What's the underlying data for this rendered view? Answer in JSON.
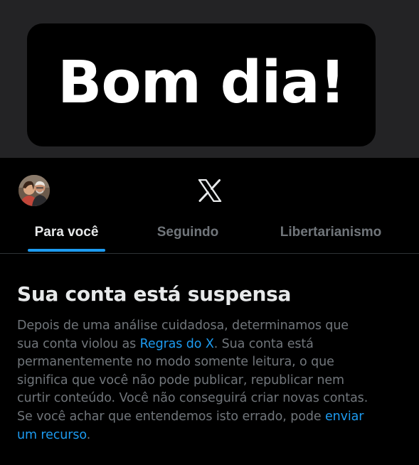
{
  "caption": {
    "text": "Bom dia!"
  },
  "header": {
    "logo_icon": "x-logo-icon",
    "avatar_icon": "profile-avatar"
  },
  "tabs": [
    {
      "label": "Para você",
      "active": true
    },
    {
      "label": "Seguindo",
      "active": false
    },
    {
      "label": "Libertarianismo",
      "active": false
    }
  ],
  "notice": {
    "title": "Sua conta está suspensa",
    "body_part1": "Depois de uma análise cuidadosa, determinamos que\nsua conta violou as ",
    "rules_link": "Regras do X",
    "body_part2": ". Sua conta está\npermanentemente no modo somente leitura, o que\nsignifica que você não pode publicar, republicar nem\ncurtir conteúdo. Você não conseguirá criar novas contas.\nSe você achar que entendemos isto errado, pode ",
    "appeal_link": "enviar\num recurso",
    "body_end": "."
  },
  "colors": {
    "background": "#000000",
    "top_area": "#232325",
    "text_primary": "#e7e9ea",
    "text_secondary": "#71767b",
    "accent": "#1d9bf0"
  }
}
